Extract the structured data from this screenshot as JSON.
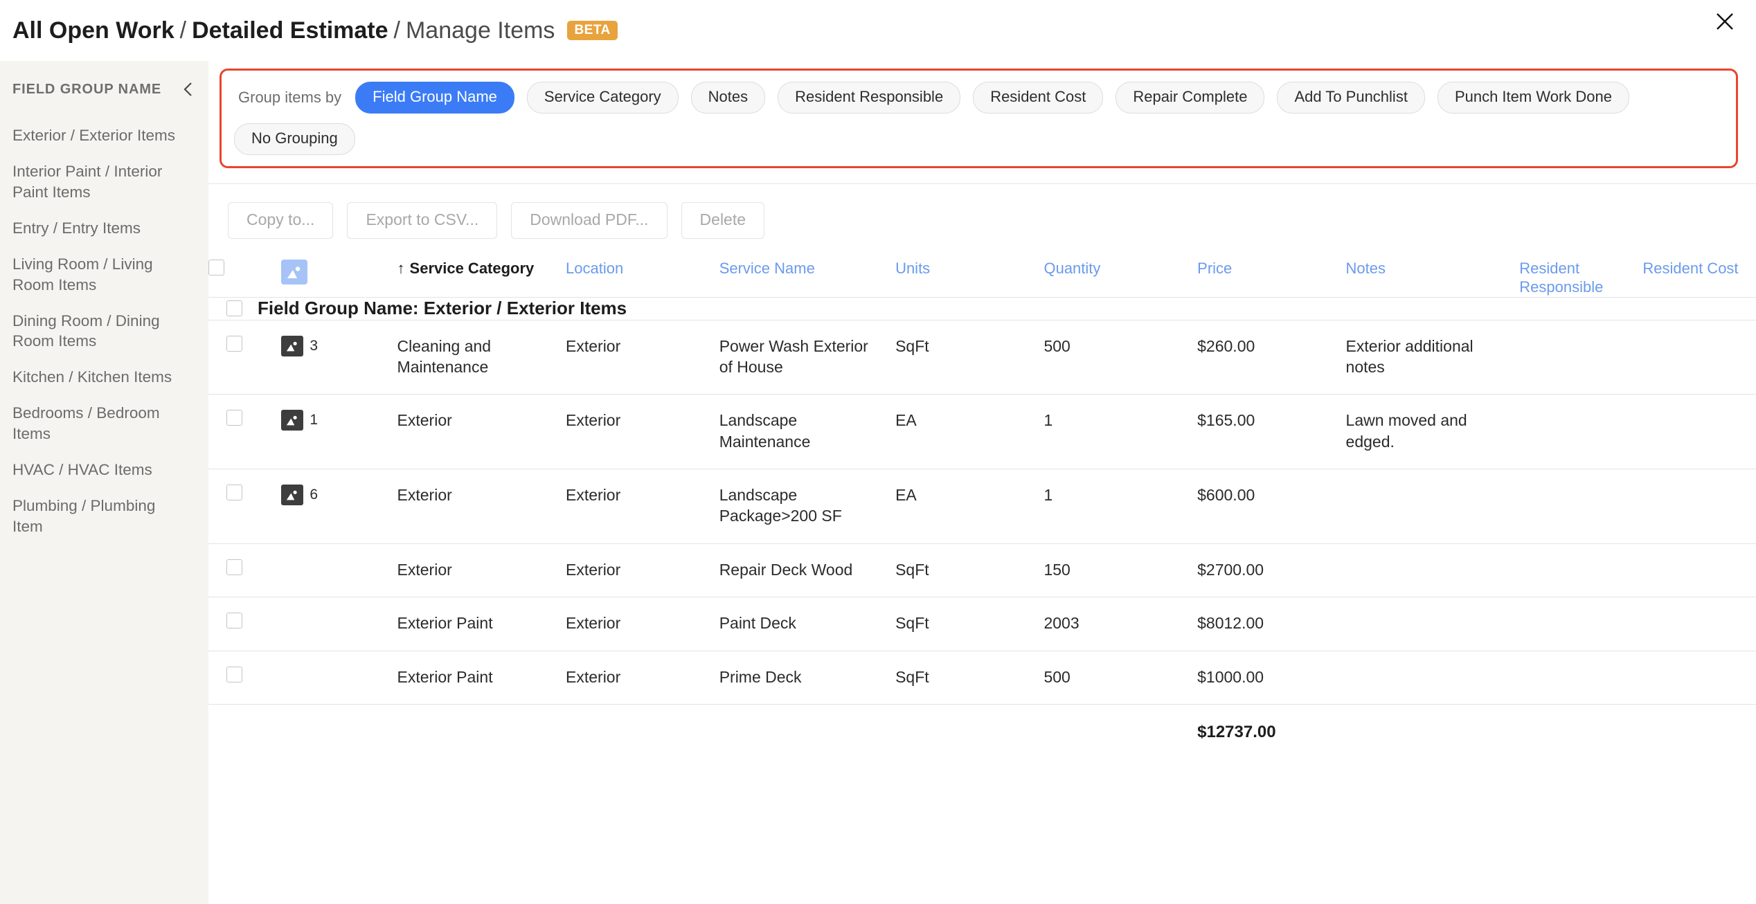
{
  "header": {
    "breadcrumb": {
      "part1": "All Open Work",
      "sep1": "/",
      "part2": "Detailed Estimate",
      "sep2": "/",
      "part3": "Manage Items"
    },
    "badge": "BETA",
    "close_icon": "close-icon"
  },
  "sidebar": {
    "title": "FIELD GROUP NAME",
    "collapse_icon": "chevron-left-icon",
    "items": [
      {
        "label": "Exterior / Exterior Items"
      },
      {
        "label": "Interior Paint / Interior Paint Items"
      },
      {
        "label": "Entry / Entry Items"
      },
      {
        "label": "Living Room / Living Room Items"
      },
      {
        "label": "Dining Room / Dining Room Items"
      },
      {
        "label": "Kitchen / Kitchen Items"
      },
      {
        "label": "Bedrooms / Bedroom Items"
      },
      {
        "label": "HVAC / HVAC Items"
      },
      {
        "label": "Plumbing / Plumbing Item"
      }
    ]
  },
  "groupby": {
    "label": "Group items by",
    "highlight_color": "#e8452c",
    "active_color": "#3b7cf6",
    "chips": [
      {
        "label": "Field Group Name",
        "active": true
      },
      {
        "label": "Service Category",
        "active": false
      },
      {
        "label": "Notes",
        "active": false
      },
      {
        "label": "Resident Responsible",
        "active": false
      },
      {
        "label": "Resident Cost",
        "active": false
      },
      {
        "label": "Repair Complete",
        "active": false
      },
      {
        "label": "Add To Punchlist",
        "active": false
      },
      {
        "label": "Punch Item Work Done",
        "active": false
      },
      {
        "label": "No Grouping",
        "active": false
      }
    ]
  },
  "actions": [
    {
      "label": "Copy to...",
      "disabled": true
    },
    {
      "label": "Export to CSV...",
      "disabled": true
    },
    {
      "label": "Download PDF...",
      "disabled": true
    },
    {
      "label": "Delete",
      "disabled": true
    }
  ],
  "table": {
    "sort_arrow": "↑",
    "photo_header_icon": "image-icon",
    "columns": [
      {
        "key": "check",
        "label": "",
        "type": "checkbox"
      },
      {
        "key": "photo",
        "label": "",
        "type": "icon"
      },
      {
        "key": "category",
        "label": "Service Category",
        "sorted": true
      },
      {
        "key": "location",
        "label": "Location",
        "sorted": false
      },
      {
        "key": "service",
        "label": "Service Name",
        "sorted": false
      },
      {
        "key": "units",
        "label": "Units",
        "sorted": false
      },
      {
        "key": "quantity",
        "label": "Quantity",
        "sorted": false
      },
      {
        "key": "price",
        "label": "Price",
        "sorted": false
      },
      {
        "key": "notes",
        "label": "Notes",
        "sorted": false
      },
      {
        "key": "resident_responsible",
        "label": "Resident Responsible",
        "sorted": false
      },
      {
        "key": "resident_cost",
        "label": "Resident Cost",
        "sorted": false
      }
    ],
    "group_header": "Field Group Name: Exterior / Exterior Items",
    "rows": [
      {
        "photo_count": "3",
        "category": "Cleaning and Maintenance",
        "location": "Exterior",
        "service": "Power Wash Exterior of House",
        "units": "SqFt",
        "quantity": "500",
        "price": "$260.00",
        "notes": "Exterior additional notes",
        "resident_responsible": "",
        "resident_cost": ""
      },
      {
        "photo_count": "1",
        "category": "Exterior",
        "location": "Exterior",
        "service": "Landscape Maintenance",
        "units": "EA",
        "quantity": "1",
        "price": "$165.00",
        "notes": "Lawn moved and edged.",
        "resident_responsible": "",
        "resident_cost": ""
      },
      {
        "photo_count": "6",
        "category": "Exterior",
        "location": "Exterior",
        "service": "Landscape Package>200 SF",
        "units": "EA",
        "quantity": "1",
        "price": "$600.00",
        "notes": "",
        "resident_responsible": "",
        "resident_cost": ""
      },
      {
        "photo_count": "",
        "category": "Exterior",
        "location": "Exterior",
        "service": "Repair Deck Wood",
        "units": "SqFt",
        "quantity": "150",
        "price": "$2700.00",
        "notes": "",
        "resident_responsible": "",
        "resident_cost": ""
      },
      {
        "photo_count": "",
        "category": "Exterior Paint",
        "location": "Exterior",
        "service": "Paint Deck",
        "units": "SqFt",
        "quantity": "2003",
        "price": "$8012.00",
        "notes": "",
        "resident_responsible": "",
        "resident_cost": ""
      },
      {
        "photo_count": "",
        "category": "Exterior Paint",
        "location": "Exterior",
        "service": "Prime Deck",
        "units": "SqFt",
        "quantity": "500",
        "price": "$1000.00",
        "notes": "",
        "resident_responsible": "",
        "resident_cost": ""
      }
    ],
    "total": "$12737.00"
  }
}
